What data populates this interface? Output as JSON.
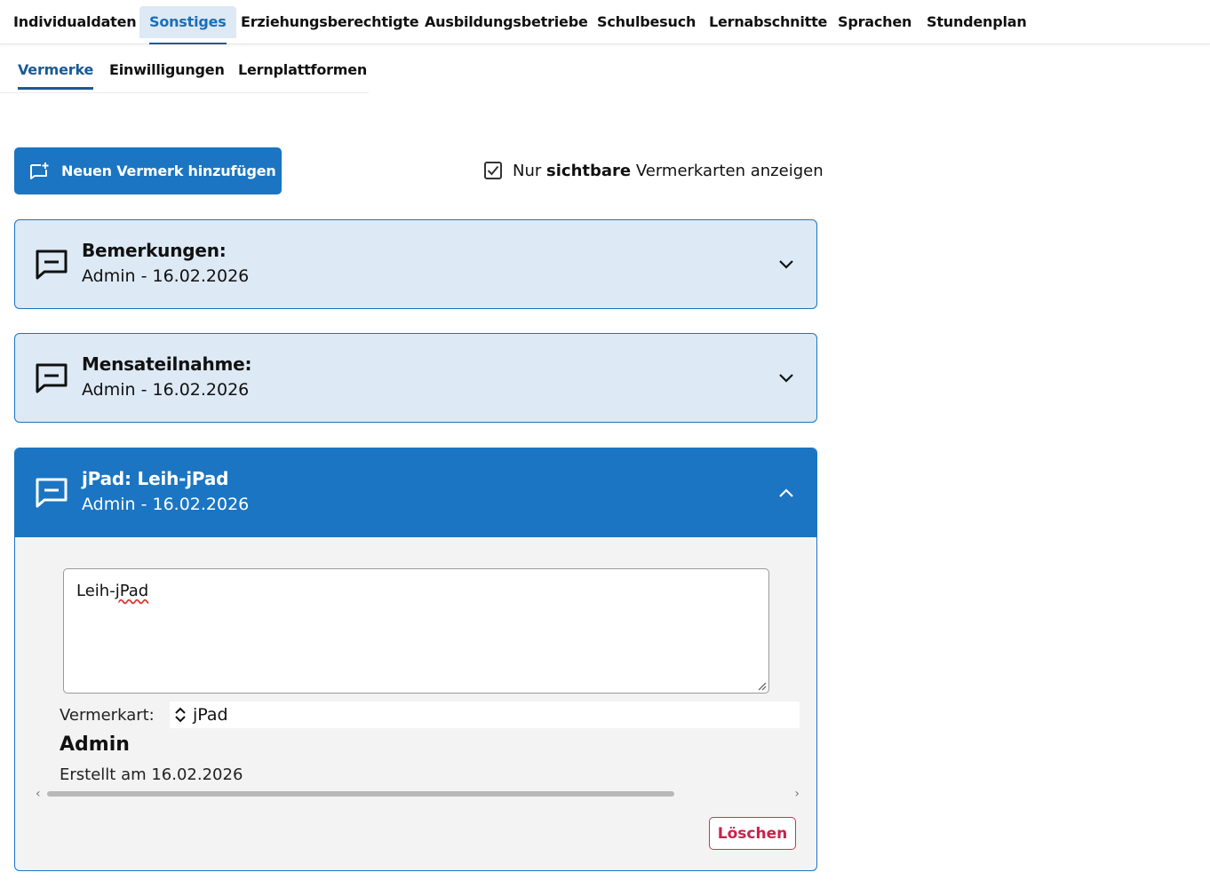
{
  "topnav": {
    "tabs": [
      {
        "label": "Individualdaten"
      },
      {
        "label": "Sonstiges"
      },
      {
        "label": "Erziehungsberechtigte"
      },
      {
        "label": "Ausbildungsbetriebe"
      },
      {
        "label": "Schulbesuch"
      },
      {
        "label": "Lernabschnitte"
      },
      {
        "label": "Sprachen"
      },
      {
        "label": "Stundenplan"
      }
    ],
    "active": "Sonstiges"
  },
  "subnav": {
    "tabs": [
      {
        "label": "Vermerke"
      },
      {
        "label": "Einwilligungen"
      },
      {
        "label": "Lernplattformen"
      }
    ],
    "active": "Vermerke"
  },
  "toolbar": {
    "add_label": "Neuen Vermerk hinzufügen",
    "visible_prefix": "Nur",
    "visible_bold": "sichtbare",
    "visible_suffix": "Vermerkarten anzeigen",
    "visible_checked": true
  },
  "cards": [
    {
      "title": "Bemerkungen:",
      "meta": "Admin - 16.02.2026",
      "expanded": false
    },
    {
      "title": "Mensateilnahme:",
      "meta": "Admin - 16.02.2026",
      "expanded": false
    },
    {
      "title": "jPad: Leih-jPad",
      "meta": "Admin - 16.02.2026",
      "expanded": true,
      "note_prefix": "Leih-",
      "note_misspelled": "jPad",
      "kind_label": "Vermerkart:",
      "kind_value": "jPad",
      "author": "Admin",
      "created": "Erstellt am 16.02.2026",
      "delete_label": "Löschen"
    }
  ],
  "colors": {
    "primary": "#1b75c2",
    "card_bg": "#dde9f5",
    "danger": "#c8234a"
  }
}
